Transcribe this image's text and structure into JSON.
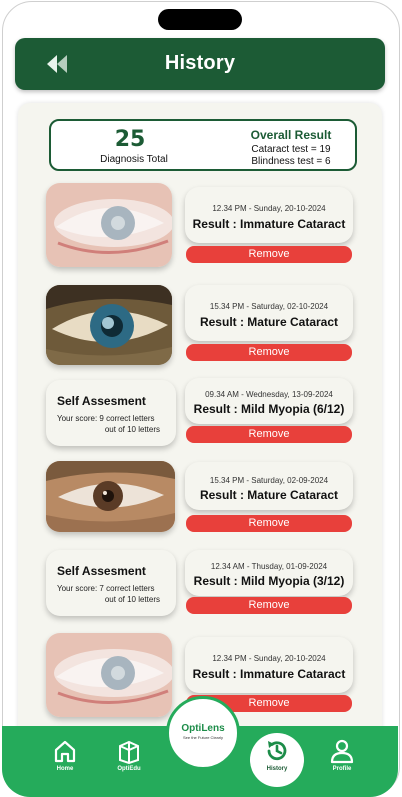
{
  "header": {
    "title": "History"
  },
  "summary": {
    "count": "25",
    "count_label": "Diagnosis Total",
    "overall_title": "Overall Result",
    "cataract_line": "Cataract test = 19",
    "blindness_line": "Blindness test = 6"
  },
  "records": [
    {
      "kind": "photo",
      "photo": "pale-eye-cataract",
      "datetime": "12.34 PM - Sunday, 20-10-2024",
      "result": "Result : Immature Cataract",
      "remove": "Remove"
    },
    {
      "kind": "photo",
      "photo": "blue-eye-mature-cataract",
      "datetime": "15.34 PM - Saturday, 02-10-2024",
      "result": "Result : Mature Cataract",
      "remove": "Remove"
    },
    {
      "kind": "self",
      "self_title": "Self Assesment",
      "score_line1": "Your score: 9 correct letters",
      "score_line2": "out of 10 letters",
      "datetime": "09.34 AM - Wednesday, 13-09-2024",
      "result": "Result : Mild Myopia (6/12)",
      "remove": "Remove"
    },
    {
      "kind": "photo",
      "photo": "brown-eye-cataract",
      "datetime": "15.34 PM - Saturday, 02-09-2024",
      "result": "Result : Mature Cataract",
      "remove": "Remove"
    },
    {
      "kind": "self",
      "self_title": "Self Assesment",
      "score_line1": "Your score: 7 correct letters",
      "score_line2": "out of 10 letters",
      "datetime": "12.34 AM - Thusday, 01-09-2024",
      "result": "Result : Mild Myopia (3/12)",
      "remove": "Remove"
    },
    {
      "kind": "photo",
      "photo": "pale-eye-cataract",
      "datetime": "12.34 PM - Sunday, 20-10-2024",
      "result": "Result : Immature Cataract",
      "remove": "Remove"
    }
  ],
  "logo": {
    "name": "OptiLens",
    "tagline": "See the Future Clearly"
  },
  "nav": {
    "home": "Home",
    "optiedu": "OptiEdu",
    "history": "History",
    "profile": "Profile"
  },
  "colors": {
    "primary": "#1c5b35",
    "accent": "#25ab5b",
    "danger": "#e8403b"
  },
  "icons": [
    "back-icon",
    "home-icon",
    "book-icon",
    "history-icon",
    "profile-icon"
  ]
}
